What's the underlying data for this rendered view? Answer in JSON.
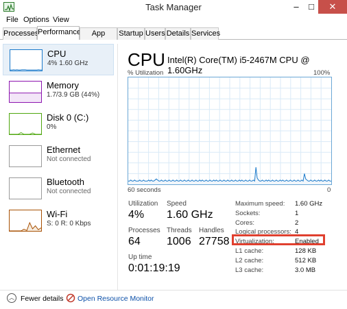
{
  "window": {
    "title": "Task Manager"
  },
  "controls": {
    "minimize": "–",
    "maximize": "□",
    "close": "✕"
  },
  "menu": [
    {
      "label": "File"
    },
    {
      "label": "Options"
    },
    {
      "label": "View"
    }
  ],
  "tabs": [
    {
      "label": "Processes"
    },
    {
      "label": "Performance"
    },
    {
      "label": "App history"
    },
    {
      "label": "Startup"
    },
    {
      "label": "Users"
    },
    {
      "label": "Details"
    },
    {
      "label": "Services"
    }
  ],
  "sidebar": [
    {
      "name": "CPU",
      "detail": "4% 1.60 GHz",
      "color": "#1979ca"
    },
    {
      "name": "Memory",
      "detail": "1.7/3.9 GB (44%)",
      "color": "#8b12ae"
    },
    {
      "name": "Disk 0 (C:)",
      "detail": "0%",
      "color": "#4da60c"
    },
    {
      "name": "Ethernet",
      "detail": "Not connected",
      "color": "#999999"
    },
    {
      "name": "Bluetooth",
      "detail": "Not connected",
      "color": "#999999"
    },
    {
      "name": "Wi-Fi",
      "detail": "S: 0 R: 0 Kbps",
      "color": "#a74f01"
    }
  ],
  "main": {
    "title": "CPU",
    "model": "Intel(R) Core(TM) i5-2467M CPU @ 1.60GHz",
    "util_label": "% Utilization",
    "util_max": "100%",
    "axis_left": "60 seconds",
    "axis_right": "0",
    "line_color": "#1979ca"
  },
  "stats": {
    "utilization_label": "Utilization",
    "utilization": "4%",
    "speed_label": "Speed",
    "speed": "1.60 GHz",
    "processes_label": "Processes",
    "processes": "64",
    "threads_label": "Threads",
    "threads": "1006",
    "handles_label": "Handles",
    "handles": "27758",
    "uptime_label": "Up time",
    "uptime": "0:01:19:19"
  },
  "info": [
    {
      "label": "Maximum speed:",
      "value": "1.60 GHz"
    },
    {
      "label": "Sockets:",
      "value": "1"
    },
    {
      "label": "Cores:",
      "value": "2"
    },
    {
      "label": "Logical processors:",
      "value": "4"
    },
    {
      "label": "Virtualization:",
      "value": "Enabled"
    },
    {
      "label": "L1 cache:",
      "value": "128 KB"
    },
    {
      "label": "L2 cache:",
      "value": "512 KB"
    },
    {
      "label": "L3 cache:",
      "value": "3.0 MB"
    }
  ],
  "footer": {
    "fewer": "Fewer details",
    "monitor": "Open Resource Monitor"
  },
  "cpu_history": [
    3,
    3,
    4,
    3,
    3,
    4,
    3,
    3,
    3,
    4,
    3,
    3,
    4,
    3,
    3,
    3,
    4,
    3,
    4,
    3,
    3,
    4,
    5,
    4,
    3,
    3,
    4,
    3,
    3,
    4,
    3,
    3,
    4,
    3,
    3,
    4,
    3,
    3,
    4,
    3,
    3,
    4,
    3,
    3,
    4,
    3,
    3,
    4,
    3,
    3,
    4,
    3,
    3,
    4,
    3,
    3,
    4,
    3,
    4,
    3,
    3,
    4,
    3,
    3,
    4,
    3,
    3,
    4,
    3,
    4,
    3,
    3,
    4,
    3,
    3,
    4,
    3,
    3,
    4,
    3,
    3,
    4,
    3,
    3,
    4,
    3,
    3,
    4,
    3,
    4,
    3,
    3,
    4,
    3,
    3,
    4,
    3,
    3,
    4,
    3,
    16,
    6,
    4,
    3,
    3,
    4,
    3,
    3,
    4,
    3,
    4,
    3,
    3,
    4,
    3,
    3,
    4,
    3,
    3,
    4,
    3,
    4,
    3,
    3,
    4,
    3,
    3,
    4,
    3,
    3,
    4,
    3,
    3,
    4,
    3,
    3,
    4,
    3,
    10,
    5,
    4,
    3,
    3,
    4,
    3,
    3,
    4,
    3,
    3,
    4,
    3,
    4,
    3,
    3,
    4,
    3,
    3,
    4,
    3,
    3
  ]
}
